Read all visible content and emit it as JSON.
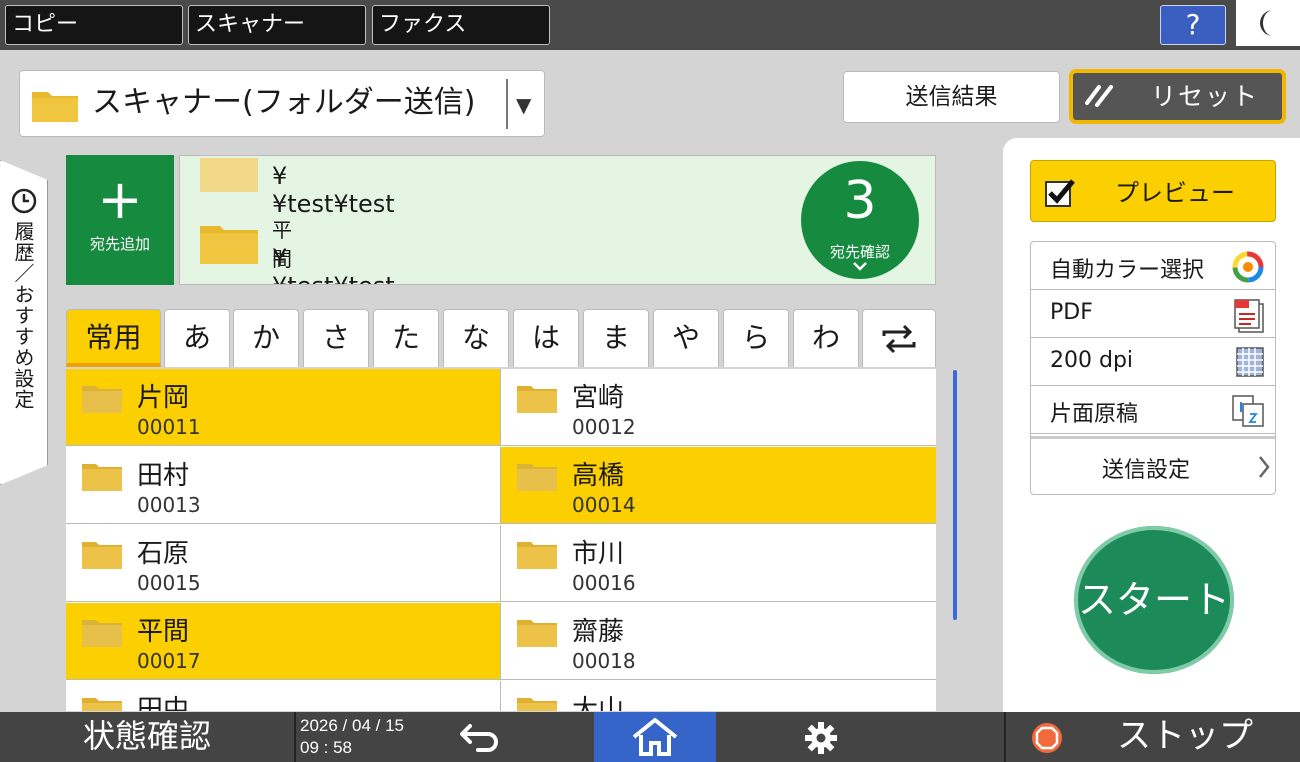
{
  "top_tabs": {
    "copy": "コピー",
    "scanner": "スキャナー",
    "fax": "ファクス"
  },
  "help_label": "?",
  "function_select": {
    "label": "スキャナー(フォルダー送信)"
  },
  "buttons": {
    "send_result": "送信結果",
    "reset": "リセット"
  },
  "side_tab": {
    "label": "履歴／おすすめ設定"
  },
  "add_destination": {
    "plus": "+",
    "label": "宛先追加"
  },
  "destinations": [
    {
      "name": "",
      "path": "¥¥test¥test"
    },
    {
      "name": "平間",
      "path": "¥¥test¥test"
    }
  ],
  "destination_confirm": {
    "count": "3",
    "label": "宛先確認"
  },
  "index_tabs": [
    "常用",
    "あ",
    "か",
    "さ",
    "た",
    "な",
    "は",
    "ま",
    "や",
    "ら",
    "わ"
  ],
  "address_list": [
    {
      "name": "片岡",
      "code": "00011",
      "selected": true
    },
    {
      "name": "宮崎",
      "code": "00012",
      "selected": false
    },
    {
      "name": "田村",
      "code": "00013",
      "selected": false
    },
    {
      "name": "高橋",
      "code": "00014",
      "selected": true
    },
    {
      "name": "石原",
      "code": "00015",
      "selected": false
    },
    {
      "name": "市川",
      "code": "00016",
      "selected": false
    },
    {
      "name": "平間",
      "code": "00017",
      "selected": true
    },
    {
      "name": "齋藤",
      "code": "00018",
      "selected": false
    },
    {
      "name": "田中",
      "code": "",
      "selected": false
    },
    {
      "name": "大山",
      "code": "",
      "selected": false
    }
  ],
  "preview": {
    "label": "プレビュー",
    "checked": true
  },
  "settings": {
    "color": "自動カラー選択",
    "format": "PDF",
    "resolution": "200 dpi",
    "original": "片面原稿",
    "send_settings": "送信設定"
  },
  "start_label": "スタート",
  "bottom": {
    "status": "状態確認",
    "date": "2026 / 04 / 15",
    "time": "09 : 58",
    "stop": "ストップ"
  },
  "colors": {
    "accent_yellow": "#fcd000",
    "green": "#168a3e",
    "start_green": "#1d8a5a",
    "home_blue": "#3565c9"
  },
  "icons": [
    "moon-icon",
    "folder-icon",
    "reset-icon",
    "clock-icon",
    "color-wheel-icon",
    "pdf-icon",
    "dpi-icon",
    "single-sided-icon",
    "back-icon",
    "home-icon",
    "gear-icon",
    "stop-icon",
    "swap-icon"
  ]
}
